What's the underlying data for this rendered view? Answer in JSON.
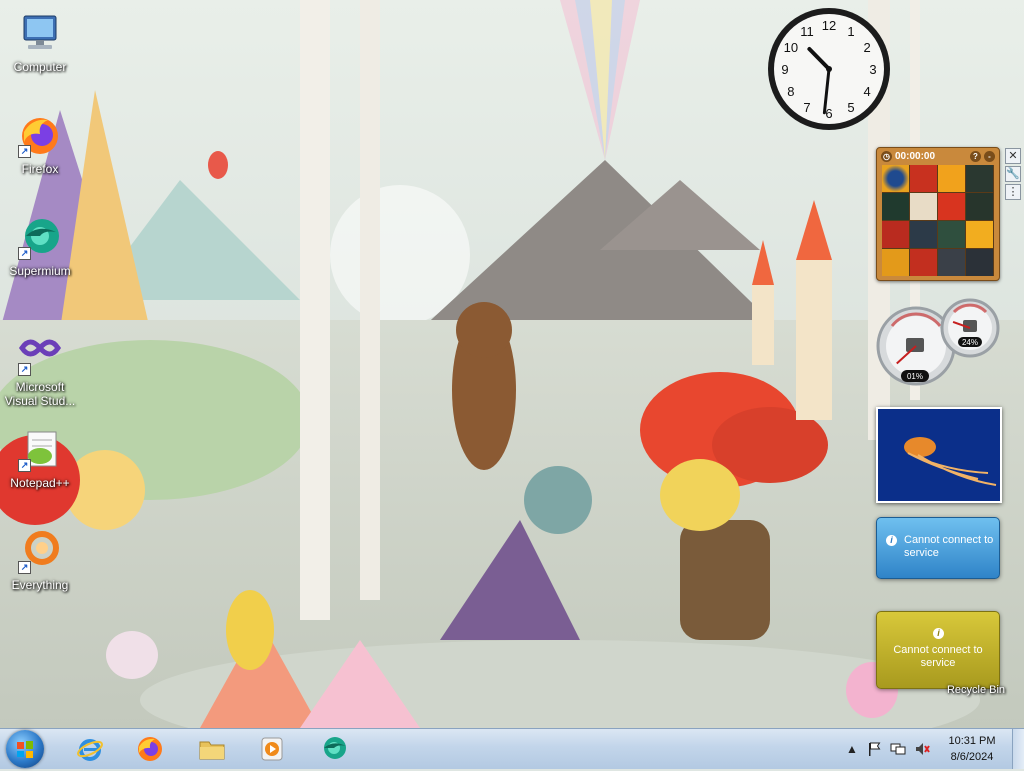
{
  "desktop": {
    "icons": [
      {
        "label": "Computer",
        "icon": "computer-icon"
      },
      {
        "label": "Firefox",
        "icon": "firefox-icon"
      },
      {
        "label": "Supermium",
        "icon": "supermium-icon"
      },
      {
        "label": "Microsoft Visual Stud...",
        "icon": "visual-studio-icon"
      },
      {
        "label": "Notepad++",
        "icon": "notepad-plus-plus-icon"
      },
      {
        "label": "Everything",
        "icon": "everything-search-icon"
      }
    ],
    "recycle_bin_label": "Recycle Bin"
  },
  "gadgets": {
    "clock": {
      "hour": 10,
      "minute": 31
    },
    "puzzle": {
      "timer": "00:00:00",
      "help": "?",
      "minimize": "-"
    },
    "cpu_meter": {
      "cpu": "01%",
      "memory": "24%",
      "cpu_value": 1,
      "memory_value": 24
    },
    "feed_headlines": {
      "message": "Cannot connect to service"
    },
    "weather": {
      "message": "Cannot connect to service"
    },
    "side_tools": {
      "close": "✕",
      "options": "🔧",
      "drag": "⋮"
    }
  },
  "taskbar": {
    "pinned": [
      {
        "name": "internet-explorer",
        "icon": "internet-explorer-icon"
      },
      {
        "name": "firefox",
        "icon": "firefox-icon"
      },
      {
        "name": "file-explorer",
        "icon": "folder-icon"
      },
      {
        "name": "media-player",
        "icon": "media-player-icon"
      },
      {
        "name": "supermium",
        "icon": "supermium-icon"
      }
    ],
    "tray": {
      "show_hidden": "▲",
      "time": "10:31 PM",
      "date": "8/6/2024"
    }
  },
  "colors": {
    "taskbar": "#c2d5ea",
    "feed_gadget": "#2f84c8",
    "weather_gadget": "#c4b62c",
    "puzzle_frame": "#c9893c"
  }
}
